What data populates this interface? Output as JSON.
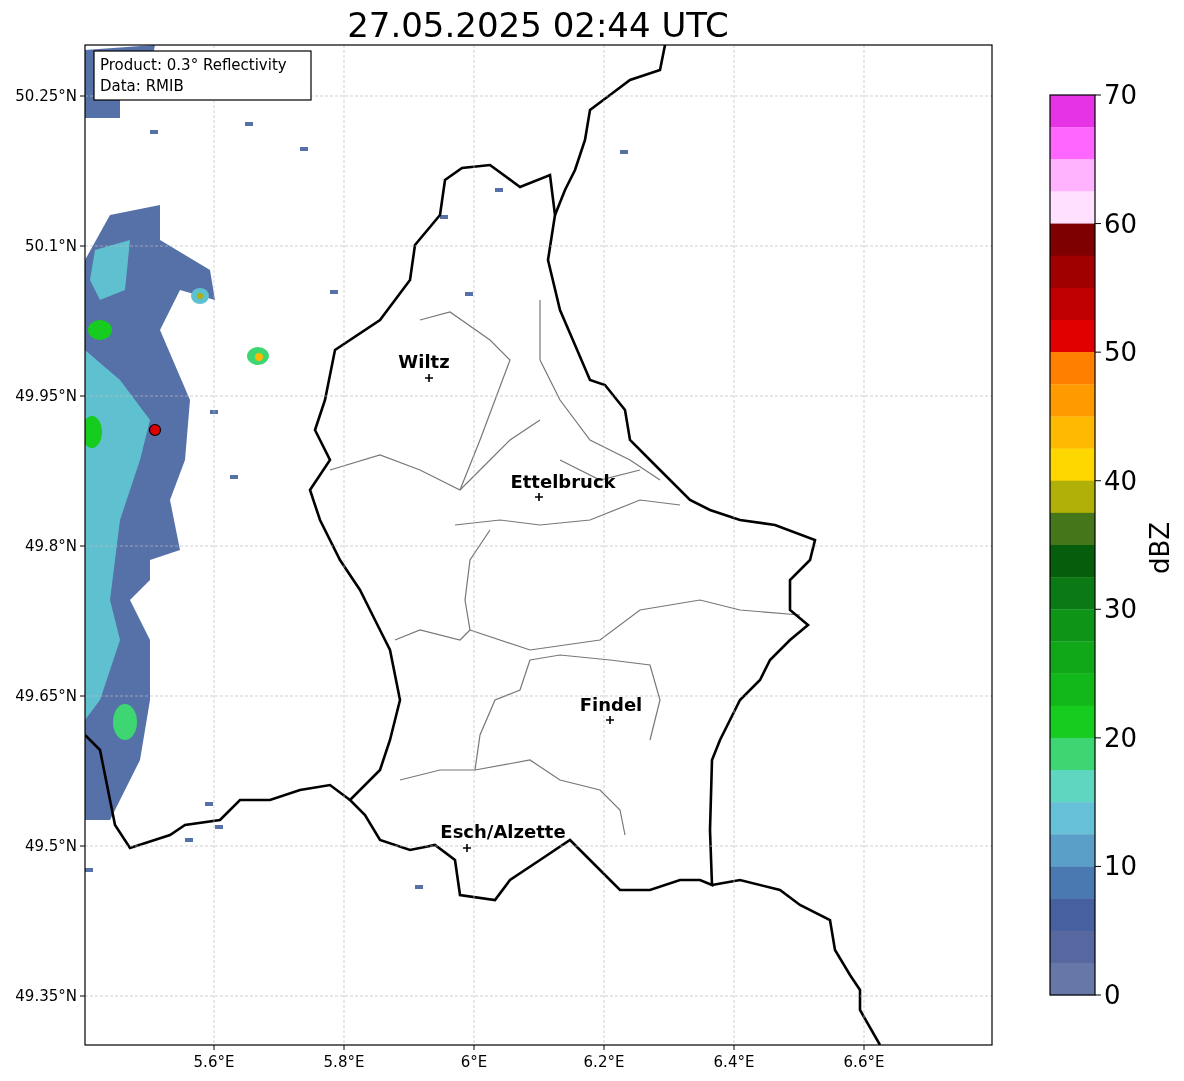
{
  "title": "27.05.2025 02:44 UTC",
  "info_box": {
    "lines": [
      "Product: 0.3° Reflectivity",
      "Data: RMIB"
    ]
  },
  "map": {
    "x_ticks": [
      "5.6°E",
      "5.8°E",
      "6°E",
      "6.2°E",
      "6.4°E",
      "6.6°E"
    ],
    "y_ticks": [
      "50.25°N",
      "50.1°N",
      "49.95°N",
      "49.8°N",
      "49.65°N",
      "49.5°N",
      "49.35°N"
    ],
    "places": [
      {
        "name": "Wiltz"
      },
      {
        "name": "Ettelbruck"
      },
      {
        "name": "Findel"
      },
      {
        "name": "Esch/Alzette"
      }
    ]
  },
  "colorbar": {
    "label": "dBZ",
    "ticks": [
      "70",
      "60",
      "50",
      "40",
      "30",
      "20",
      "10",
      "0"
    ],
    "bins": [
      {
        "color": "#e633e6"
      },
      {
        "color": "#ff66ff"
      },
      {
        "color": "#ffb3ff"
      },
      {
        "color": "#ffe0ff"
      },
      {
        "color": "#7f0000"
      },
      {
        "color": "#a00000"
      },
      {
        "color": "#c00000"
      },
      {
        "color": "#e00000"
      },
      {
        "color": "#ff7f00"
      },
      {
        "color": "#ff9b00"
      },
      {
        "color": "#ffb900"
      },
      {
        "color": "#ffd700"
      },
      {
        "color": "#b0b008"
      },
      {
        "color": "#45761a"
      },
      {
        "color": "#065e0c"
      },
      {
        "color": "#0c7a14"
      },
      {
        "color": "#0e9416"
      },
      {
        "color": "#10a818"
      },
      {
        "color": "#12b81a"
      },
      {
        "color": "#16cc1e"
      },
      {
        "color": "#3dd672"
      },
      {
        "color": "#5fd6c0"
      },
      {
        "color": "#66c0d8"
      },
      {
        "color": "#5a9fc8"
      },
      {
        "color": "#4a78b0"
      },
      {
        "color": "#4760a0"
      },
      {
        "color": "#56689f"
      },
      {
        "color": "#6677a8"
      }
    ]
  }
}
